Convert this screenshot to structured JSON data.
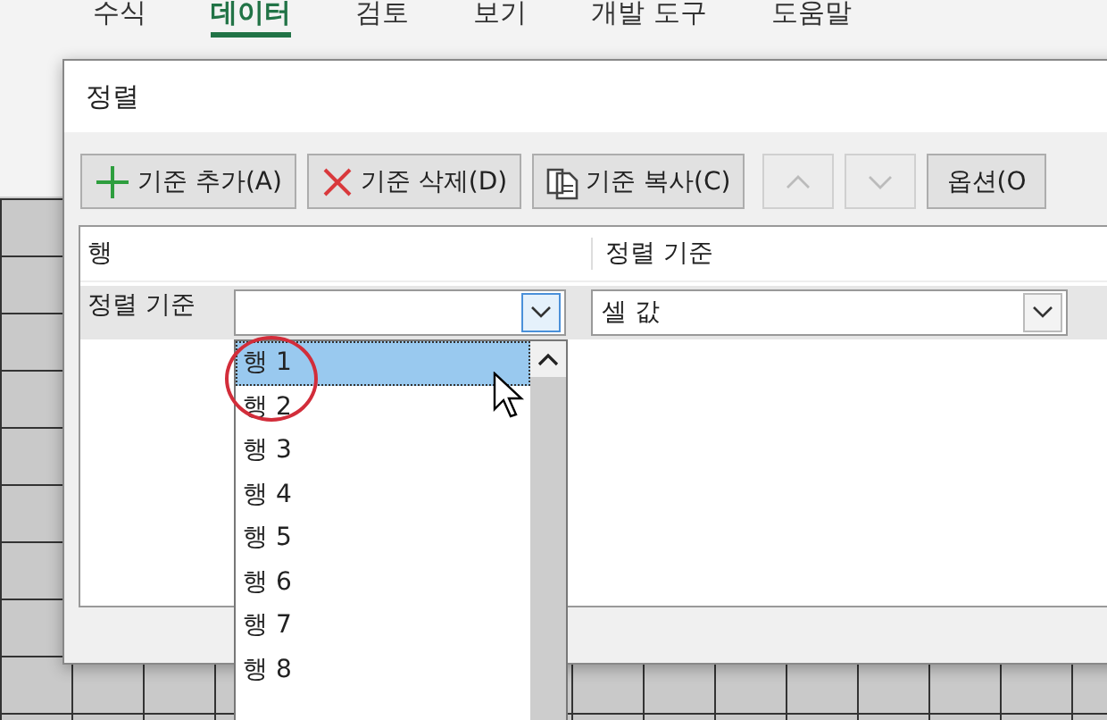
{
  "ribbon_tabs": [
    {
      "label": "수식",
      "selected": false
    },
    {
      "label": "데이터",
      "selected": true
    },
    {
      "label": "검토",
      "selected": false
    },
    {
      "label": "보기",
      "selected": false
    },
    {
      "label": "개발 도구",
      "selected": false
    },
    {
      "label": "도움말",
      "selected": false
    }
  ],
  "dialog": {
    "title": "정렬",
    "toolbar": [
      {
        "kind": "add",
        "label": "기준 추가(A)"
      },
      {
        "kind": "delete",
        "label": "기준 삭제(D)"
      },
      {
        "kind": "copy",
        "label": "기준 복사(C)"
      },
      {
        "kind": "up",
        "disabled": true
      },
      {
        "kind": "down",
        "disabled": true
      },
      {
        "kind": "text",
        "label": "옵션(O"
      }
    ],
    "columns": [
      "행",
      "정렬 기준"
    ],
    "level": {
      "label": "정렬 기준",
      "sort_on": "셀 값"
    },
    "dropdown": [
      {
        "label": "행 1",
        "selected": true
      },
      {
        "label": "행 2",
        "selected": false
      },
      {
        "label": "행 3",
        "selected": false
      },
      {
        "label": "행 4",
        "selected": false
      },
      {
        "label": "행 5",
        "selected": false
      },
      {
        "label": "행 6",
        "selected": false
      },
      {
        "label": "행 7",
        "selected": false
      },
      {
        "label": "행 8",
        "selected": false
      }
    ]
  }
}
